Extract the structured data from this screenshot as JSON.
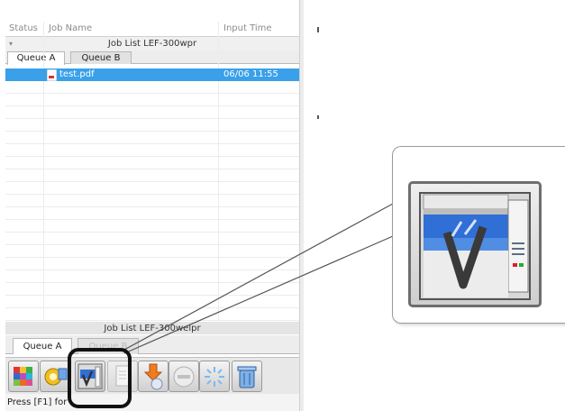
{
  "columns": {
    "status": "Status",
    "job_name": "Job Name",
    "input_time": "Input Time"
  },
  "job_list_1": {
    "title": "Job List LEF-300wpr",
    "tabs": [
      {
        "label": "Queue A",
        "selected": true
      },
      {
        "label": "Queue B",
        "selected": false
      }
    ],
    "jobs": [
      {
        "name": "test.pdf",
        "input_time": "06/06 11:55",
        "selected": true
      }
    ]
  },
  "job_list_2": {
    "title": "Job List LEF-300welpr",
    "tabs": [
      {
        "label": "Queue A",
        "selected": true
      },
      {
        "label": "Queue B",
        "selected": false
      }
    ]
  },
  "toolbar": {
    "buttons": [
      {
        "icon": "color-grid-icon"
      },
      {
        "icon": "gear-settings-icon"
      },
      {
        "icon": "printer-check-icon",
        "highlighted": true
      },
      {
        "icon": "document-icon"
      },
      {
        "icon": "import-arrow-icon"
      },
      {
        "icon": "stop-circle-icon"
      },
      {
        "icon": "cleaning-sparkle-icon"
      },
      {
        "icon": "trash-bin-icon"
      }
    ]
  },
  "status_bar": {
    "text": "Press [F1] for"
  },
  "callout": {
    "icon": "printer-check-icon"
  },
  "colors": {
    "selection": "#39a0e9",
    "highlight_border": "#111111",
    "icon_screen_blue": "#2f6fd6"
  }
}
